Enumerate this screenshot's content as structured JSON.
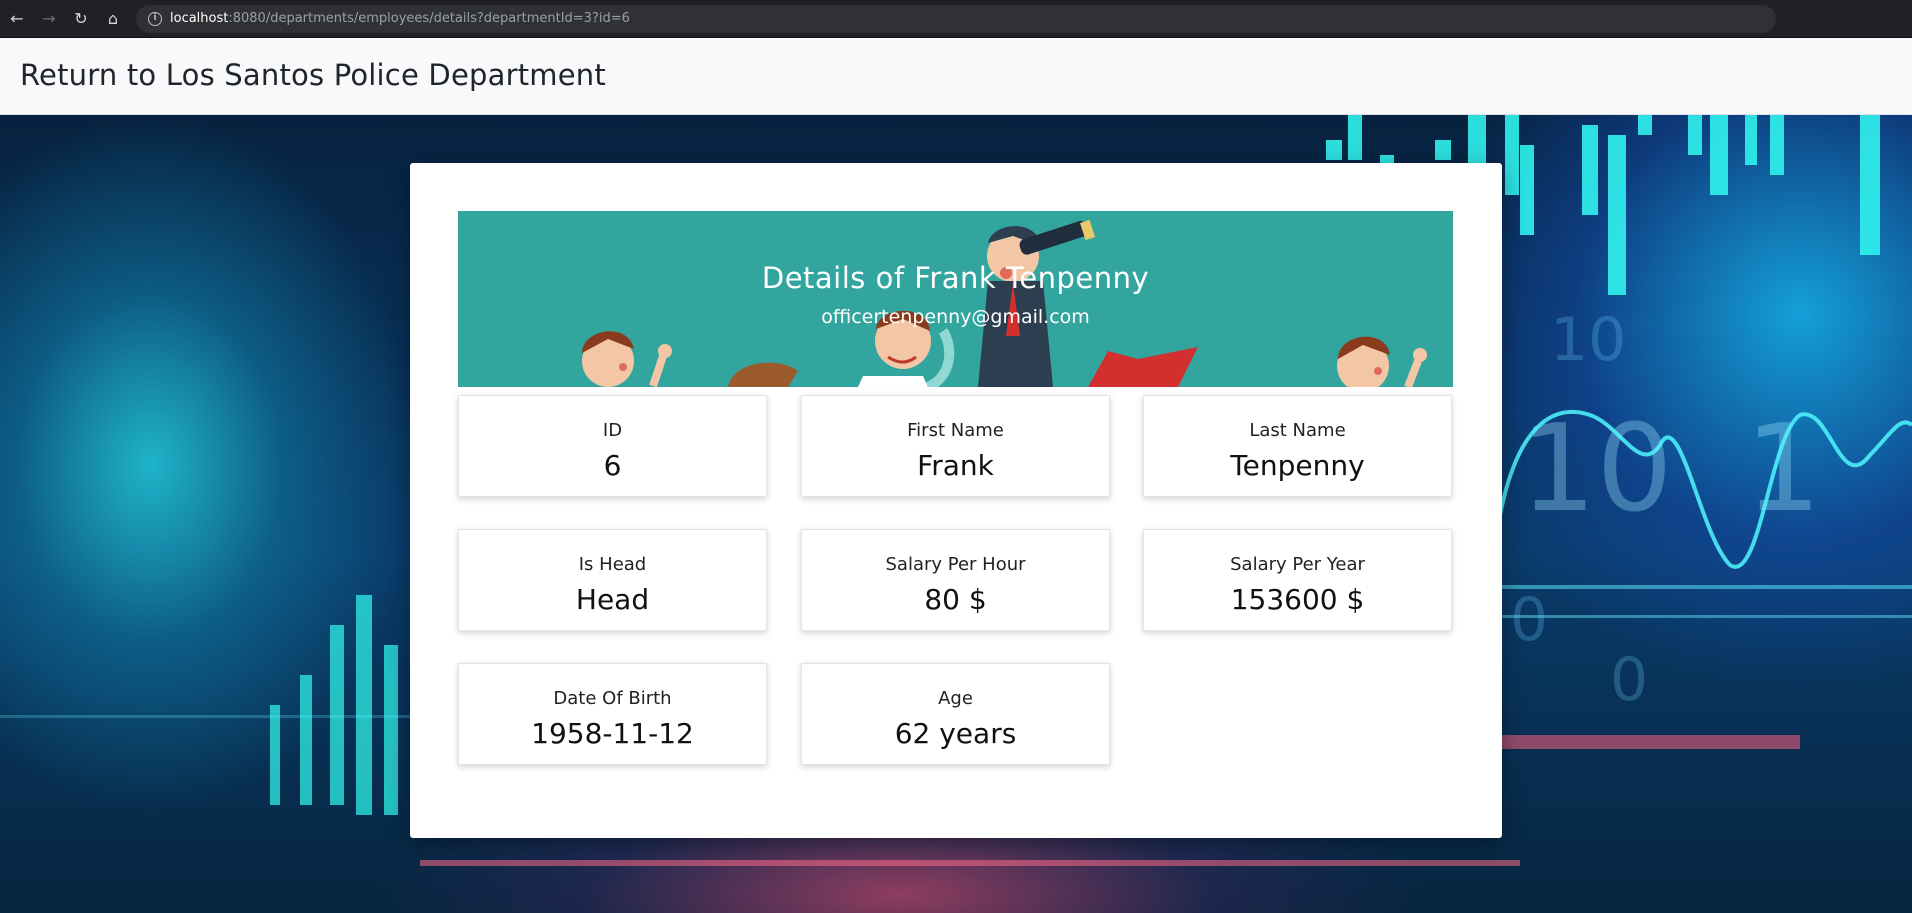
{
  "browser": {
    "url_host": "localhost",
    "url_path": ":8080/departments/employees/details?departmentId=3?id=6"
  },
  "navbar": {
    "brand_text": "Return to Los Santos Police Department"
  },
  "banner": {
    "title": "Details of Frank Tenpenny",
    "email": "officertenpenny@gmail.com"
  },
  "details": [
    {
      "label": "ID",
      "value": "6"
    },
    {
      "label": "First Name",
      "value": "Frank"
    },
    {
      "label": "Last Name",
      "value": "Tenpenny"
    },
    {
      "label": "Is Head",
      "value": "Head"
    },
    {
      "label": "Salary Per Hour",
      "value": "80 $"
    },
    {
      "label": "Salary Per Year",
      "value": "153600 $"
    },
    {
      "label": "Date Of Birth",
      "value": "1958-11-12"
    },
    {
      "label": "Age",
      "value": "62 years"
    }
  ],
  "colors": {
    "banner": "#33a59f",
    "navbar": "#f8f9fa",
    "card": "#ffffff",
    "accent_red": "#d32f2f"
  },
  "icons": {
    "back": "arrow-left",
    "forward": "arrow-right",
    "reload": "reload",
    "home": "home",
    "site_info": "info"
  }
}
